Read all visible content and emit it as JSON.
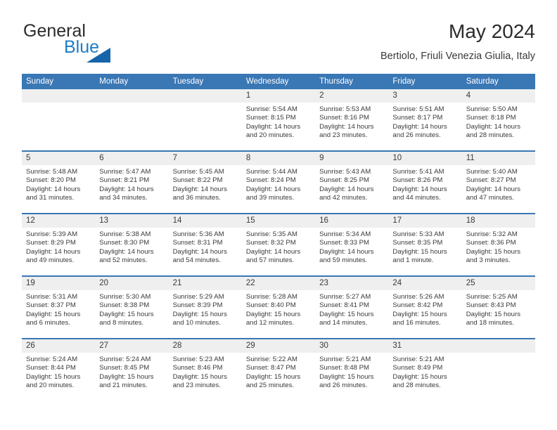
{
  "brand": {
    "name_part1": "General",
    "name_part2": "Blue",
    "triangle_color": "#1565a8",
    "blue_text_color": "#1d7cc4"
  },
  "header": {
    "title": "May 2024",
    "location": "Bertiolo, Friuli Venezia Giulia, Italy"
  },
  "theme": {
    "header_blue": "#3a77b5",
    "daynum_band": "#efefef",
    "text": "#3a3a3a"
  },
  "weekday_headers": [
    "Sunday",
    "Monday",
    "Tuesday",
    "Wednesday",
    "Thursday",
    "Friday",
    "Saturday"
  ],
  "weeks": [
    [
      {
        "day": ""
      },
      {
        "day": ""
      },
      {
        "day": ""
      },
      {
        "day": "1",
        "sunrise": "Sunrise: 5:54 AM",
        "sunset": "Sunset: 8:15 PM",
        "daylight_line1": "Daylight: 14 hours",
        "daylight_line2": "and 20 minutes."
      },
      {
        "day": "2",
        "sunrise": "Sunrise: 5:53 AM",
        "sunset": "Sunset: 8:16 PM",
        "daylight_line1": "Daylight: 14 hours",
        "daylight_line2": "and 23 minutes."
      },
      {
        "day": "3",
        "sunrise": "Sunrise: 5:51 AM",
        "sunset": "Sunset: 8:17 PM",
        "daylight_line1": "Daylight: 14 hours",
        "daylight_line2": "and 26 minutes."
      },
      {
        "day": "4",
        "sunrise": "Sunrise: 5:50 AM",
        "sunset": "Sunset: 8:18 PM",
        "daylight_line1": "Daylight: 14 hours",
        "daylight_line2": "and 28 minutes."
      }
    ],
    [
      {
        "day": "5",
        "sunrise": "Sunrise: 5:48 AM",
        "sunset": "Sunset: 8:20 PM",
        "daylight_line1": "Daylight: 14 hours",
        "daylight_line2": "and 31 minutes."
      },
      {
        "day": "6",
        "sunrise": "Sunrise: 5:47 AM",
        "sunset": "Sunset: 8:21 PM",
        "daylight_line1": "Daylight: 14 hours",
        "daylight_line2": "and 34 minutes."
      },
      {
        "day": "7",
        "sunrise": "Sunrise: 5:45 AM",
        "sunset": "Sunset: 8:22 PM",
        "daylight_line1": "Daylight: 14 hours",
        "daylight_line2": "and 36 minutes."
      },
      {
        "day": "8",
        "sunrise": "Sunrise: 5:44 AM",
        "sunset": "Sunset: 8:24 PM",
        "daylight_line1": "Daylight: 14 hours",
        "daylight_line2": "and 39 minutes."
      },
      {
        "day": "9",
        "sunrise": "Sunrise: 5:43 AM",
        "sunset": "Sunset: 8:25 PM",
        "daylight_line1": "Daylight: 14 hours",
        "daylight_line2": "and 42 minutes."
      },
      {
        "day": "10",
        "sunrise": "Sunrise: 5:41 AM",
        "sunset": "Sunset: 8:26 PM",
        "daylight_line1": "Daylight: 14 hours",
        "daylight_line2": "and 44 minutes."
      },
      {
        "day": "11",
        "sunrise": "Sunrise: 5:40 AM",
        "sunset": "Sunset: 8:27 PM",
        "daylight_line1": "Daylight: 14 hours",
        "daylight_line2": "and 47 minutes."
      }
    ],
    [
      {
        "day": "12",
        "sunrise": "Sunrise: 5:39 AM",
        "sunset": "Sunset: 8:29 PM",
        "daylight_line1": "Daylight: 14 hours",
        "daylight_line2": "and 49 minutes."
      },
      {
        "day": "13",
        "sunrise": "Sunrise: 5:38 AM",
        "sunset": "Sunset: 8:30 PM",
        "daylight_line1": "Daylight: 14 hours",
        "daylight_line2": "and 52 minutes."
      },
      {
        "day": "14",
        "sunrise": "Sunrise: 5:36 AM",
        "sunset": "Sunset: 8:31 PM",
        "daylight_line1": "Daylight: 14 hours",
        "daylight_line2": "and 54 minutes."
      },
      {
        "day": "15",
        "sunrise": "Sunrise: 5:35 AM",
        "sunset": "Sunset: 8:32 PM",
        "daylight_line1": "Daylight: 14 hours",
        "daylight_line2": "and 57 minutes."
      },
      {
        "day": "16",
        "sunrise": "Sunrise: 5:34 AM",
        "sunset": "Sunset: 8:33 PM",
        "daylight_line1": "Daylight: 14 hours",
        "daylight_line2": "and 59 minutes."
      },
      {
        "day": "17",
        "sunrise": "Sunrise: 5:33 AM",
        "sunset": "Sunset: 8:35 PM",
        "daylight_line1": "Daylight: 15 hours",
        "daylight_line2": "and 1 minute."
      },
      {
        "day": "18",
        "sunrise": "Sunrise: 5:32 AM",
        "sunset": "Sunset: 8:36 PM",
        "daylight_line1": "Daylight: 15 hours",
        "daylight_line2": "and 3 minutes."
      }
    ],
    [
      {
        "day": "19",
        "sunrise": "Sunrise: 5:31 AM",
        "sunset": "Sunset: 8:37 PM",
        "daylight_line1": "Daylight: 15 hours",
        "daylight_line2": "and 6 minutes."
      },
      {
        "day": "20",
        "sunrise": "Sunrise: 5:30 AM",
        "sunset": "Sunset: 8:38 PM",
        "daylight_line1": "Daylight: 15 hours",
        "daylight_line2": "and 8 minutes."
      },
      {
        "day": "21",
        "sunrise": "Sunrise: 5:29 AM",
        "sunset": "Sunset: 8:39 PM",
        "daylight_line1": "Daylight: 15 hours",
        "daylight_line2": "and 10 minutes."
      },
      {
        "day": "22",
        "sunrise": "Sunrise: 5:28 AM",
        "sunset": "Sunset: 8:40 PM",
        "daylight_line1": "Daylight: 15 hours",
        "daylight_line2": "and 12 minutes."
      },
      {
        "day": "23",
        "sunrise": "Sunrise: 5:27 AM",
        "sunset": "Sunset: 8:41 PM",
        "daylight_line1": "Daylight: 15 hours",
        "daylight_line2": "and 14 minutes."
      },
      {
        "day": "24",
        "sunrise": "Sunrise: 5:26 AM",
        "sunset": "Sunset: 8:42 PM",
        "daylight_line1": "Daylight: 15 hours",
        "daylight_line2": "and 16 minutes."
      },
      {
        "day": "25",
        "sunrise": "Sunrise: 5:25 AM",
        "sunset": "Sunset: 8:43 PM",
        "daylight_line1": "Daylight: 15 hours",
        "daylight_line2": "and 18 minutes."
      }
    ],
    [
      {
        "day": "26",
        "sunrise": "Sunrise: 5:24 AM",
        "sunset": "Sunset: 8:44 PM",
        "daylight_line1": "Daylight: 15 hours",
        "daylight_line2": "and 20 minutes."
      },
      {
        "day": "27",
        "sunrise": "Sunrise: 5:24 AM",
        "sunset": "Sunset: 8:45 PM",
        "daylight_line1": "Daylight: 15 hours",
        "daylight_line2": "and 21 minutes."
      },
      {
        "day": "28",
        "sunrise": "Sunrise: 5:23 AM",
        "sunset": "Sunset: 8:46 PM",
        "daylight_line1": "Daylight: 15 hours",
        "daylight_line2": "and 23 minutes."
      },
      {
        "day": "29",
        "sunrise": "Sunrise: 5:22 AM",
        "sunset": "Sunset: 8:47 PM",
        "daylight_line1": "Daylight: 15 hours",
        "daylight_line2": "and 25 minutes."
      },
      {
        "day": "30",
        "sunrise": "Sunrise: 5:21 AM",
        "sunset": "Sunset: 8:48 PM",
        "daylight_line1": "Daylight: 15 hours",
        "daylight_line2": "and 26 minutes."
      },
      {
        "day": "31",
        "sunrise": "Sunrise: 5:21 AM",
        "sunset": "Sunset: 8:49 PM",
        "daylight_line1": "Daylight: 15 hours",
        "daylight_line2": "and 28 minutes."
      },
      {
        "day": ""
      }
    ]
  ]
}
